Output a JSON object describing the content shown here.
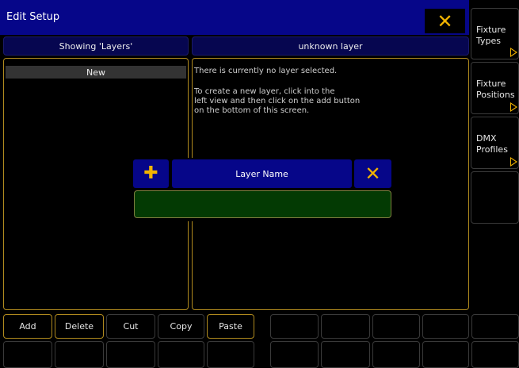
{
  "window": {
    "title": "Edit Setup"
  },
  "sidebar": {
    "items": [
      {
        "label": "Fixture Types"
      },
      {
        "label": "Fixture Positions"
      },
      {
        "label": "DMX Profiles"
      }
    ]
  },
  "left_panel": {
    "header": "Showing 'Layers'",
    "rows": [
      "New"
    ]
  },
  "right_panel": {
    "header": "unknown layer",
    "message_line1": "There is currently no layer selected.",
    "message_line2": "To create a new layer, click into the",
    "message_line3": "left view and then click on the add button",
    "message_line4": "on the bottom of this screen."
  },
  "dialog": {
    "title": "Layer Name",
    "input_value": ""
  },
  "bottom_bar": {
    "buttons": [
      "Add",
      "Delete",
      "Cut",
      "Copy",
      "Paste"
    ]
  },
  "colors": {
    "accent": "#f2b400",
    "title_bar": "#060689",
    "panel_border": "#b08a1e",
    "input_bg": "#033a03"
  }
}
